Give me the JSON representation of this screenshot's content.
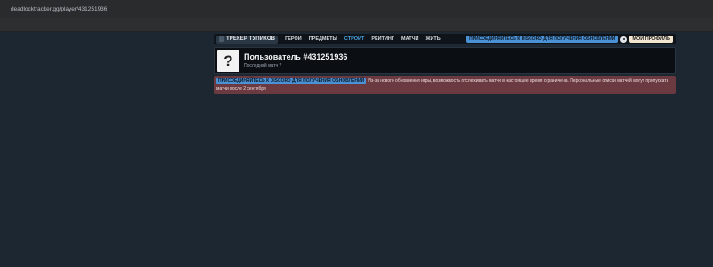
{
  "browser": {
    "url": "deadlocktracker.gg/player/431251936"
  },
  "nav": {
    "logo_label": "ТРЕКЕР ТУПИКОВ",
    "links": [
      "ГЕРОИ",
      "ПРЕДМЕТЫ",
      "СТРОИТ",
      "РЕЙТИНГ",
      "МАТЧИ",
      "ЖИТЬ"
    ],
    "active_link": "СТРОИТ",
    "discord_label": "ПРИСОЕДИНЯЙТЕСЬ К DISCORD ДЛЯ ПОЛУЧЕНИЯ ОБНОВЛЕНИЙ",
    "settings_icon": "gear-icon",
    "profile_label": "МОЙ ПРОФИЛЬ"
  },
  "player": {
    "avatar_glyph": "?",
    "name": "Пользователь #431251936",
    "last_match": "Последний матч ?"
  },
  "notice": {
    "badge": "ПРИСОЕДИНЯЙТЕСЬ К DISCORD ДЛЯ ПОЛУЧЕНИЯ ОБНОВЛЕНИЙ",
    "text": "Из-за нового обновления игры, возможность отслеживать матчи в настоящее время ограничена. Персональные списки матчей могут пропускать матчи после 2 сентября"
  },
  "colors": {
    "page_bg": "#1d2731",
    "accent": "#4b91d6",
    "notice_bg": "#6a3a40",
    "active_link": "#49a6e2"
  }
}
